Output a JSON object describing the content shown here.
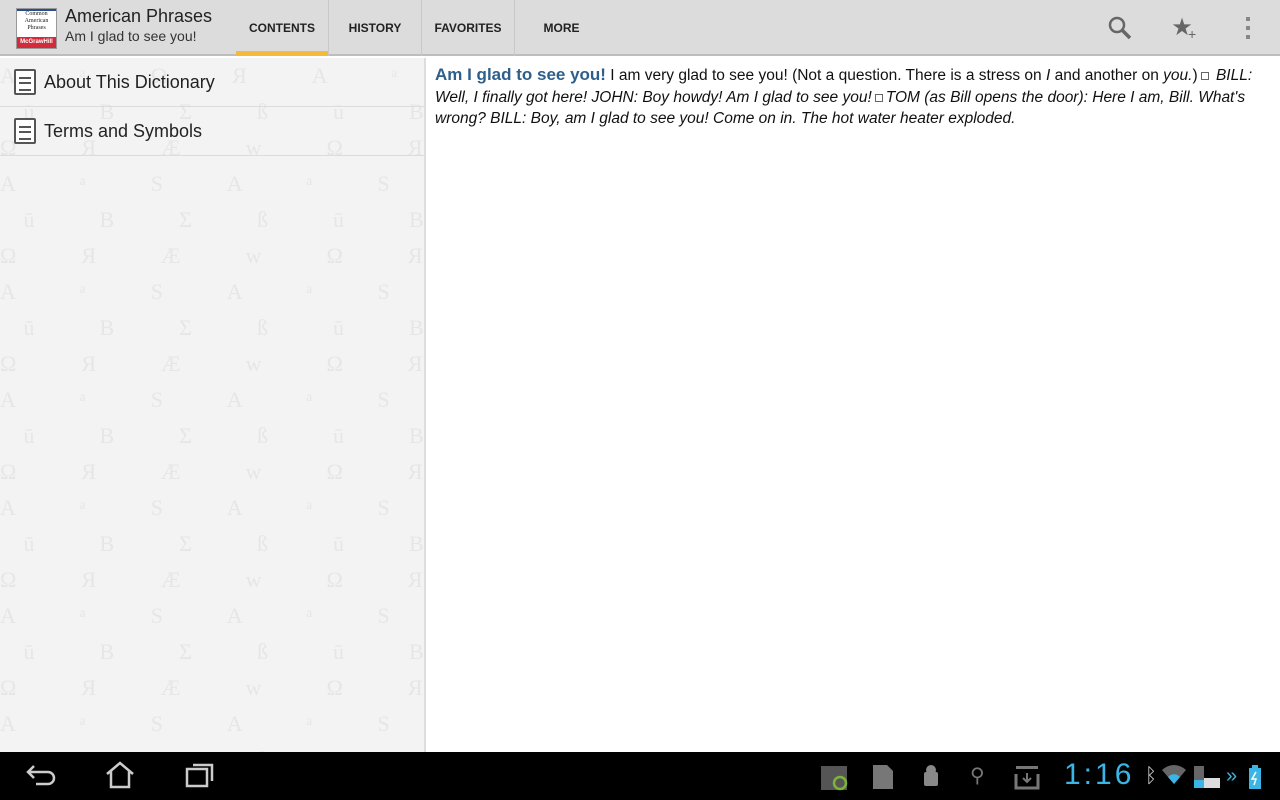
{
  "app": {
    "title": "American Phrases",
    "subtitle": "Am I glad to see you!",
    "logo_text": "Common American Phrases McGraw-Hill"
  },
  "tabs": [
    {
      "label": "CONTENTS",
      "active": true
    },
    {
      "label": "HISTORY"
    },
    {
      "label": "FAVORITES"
    },
    {
      "label": "MORE"
    }
  ],
  "actions": {
    "search": "search-icon",
    "favorite": "star-add-icon",
    "overflow": "overflow-menu-icon"
  },
  "accent": "#f5b93b",
  "sidebar": {
    "items": [
      {
        "label": "About This Dictionary"
      },
      {
        "label": "Terms and Symbols"
      }
    ]
  },
  "entry": {
    "headword": "Am I glad to see you!",
    "def1": " I am very glad to see you! (Not a question. There is a stress on ",
    "def_i": "I",
    "def2": " and another on ",
    "def_you": "you.",
    "def3": ")",
    "ex1": "BILL: Well, I finally got here! JOHN: Boy howdy! Am I glad to see you!",
    "ex2": "TOM (as Bill opens the door): Here I am, Bill. What's wrong? BILL: Boy, am I glad to see you! Come on in. The hot water heater exploded."
  },
  "statusbar": {
    "time": "1:16"
  }
}
